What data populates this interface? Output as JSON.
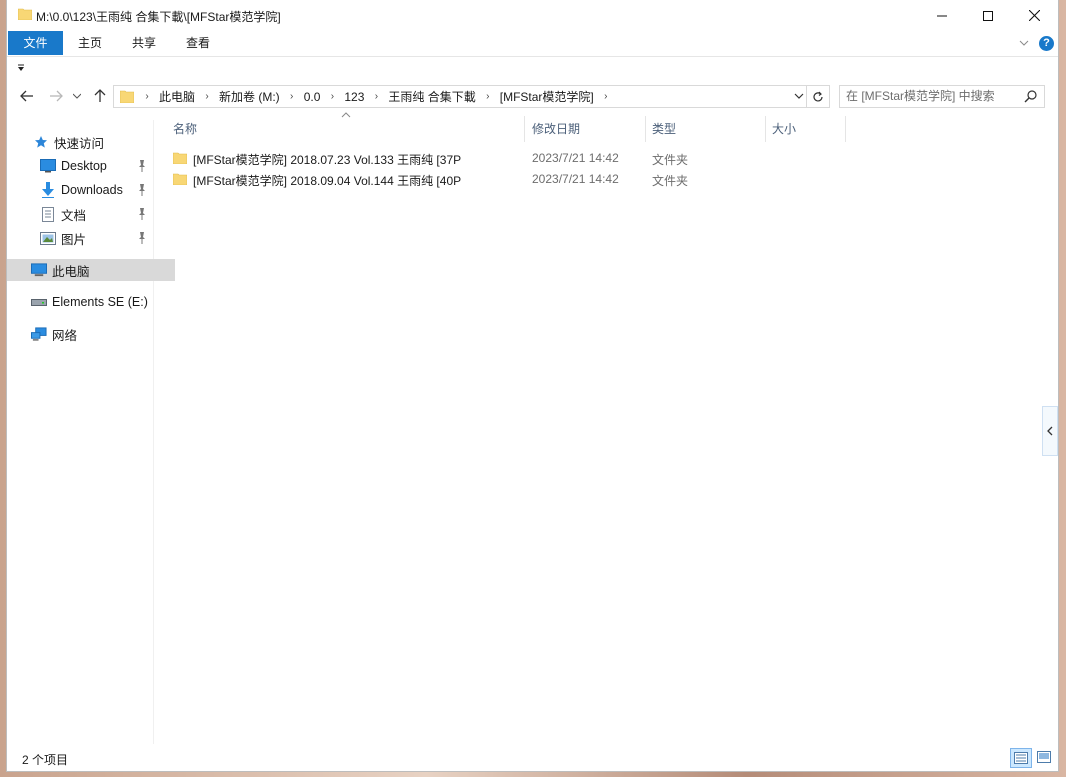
{
  "window": {
    "title": "M:\\0.0\\123\\王雨纯 合集下載\\[MFStar模范学院]"
  },
  "ribbon": {
    "tabs": [
      "文件",
      "主页",
      "共享",
      "查看"
    ],
    "help": "?"
  },
  "address": {
    "crumbs": [
      "此电脑",
      "新加卷 (M:)",
      "0.0",
      "123",
      "王雨纯 合集下載",
      "[MFStar模范学院]"
    ]
  },
  "search": {
    "placeholder": "在 [MFStar模范学院] 中搜索"
  },
  "sidebar": {
    "items": [
      {
        "label": "快速访问",
        "icon": "star-icon"
      },
      {
        "label": "Desktop",
        "icon": "desktop-icon",
        "pinned": true
      },
      {
        "label": "Downloads",
        "icon": "download-icon",
        "pinned": true
      },
      {
        "label": "文档",
        "icon": "document-icon",
        "pinned": true
      },
      {
        "label": "图片",
        "icon": "picture-icon",
        "pinned": true
      },
      {
        "label": "此电脑",
        "icon": "computer-icon",
        "selected": true
      },
      {
        "label": "Elements SE (E:)",
        "icon": "drive-icon"
      },
      {
        "label": "网络",
        "icon": "network-icon"
      }
    ]
  },
  "columns": {
    "name": "名称",
    "date": "修改日期",
    "type": "类型",
    "size": "大小"
  },
  "files": [
    {
      "name": "[MFStar模范学院] 2018.07.23 Vol.133 王雨纯 [37P",
      "date": "2023/7/21 14:42",
      "type": "文件夹"
    },
    {
      "name": "[MFStar模范学院] 2018.09.04 Vol.144 王雨纯 [40P",
      "date": "2023/7/21 14:42",
      "type": "文件夹"
    }
  ],
  "status": {
    "count": "2 个项目"
  },
  "colors": {
    "accent": "#1979ca",
    "folder": "#f8d775",
    "selected_bg": "#d9d9d9",
    "header_text": "#4c607a"
  }
}
